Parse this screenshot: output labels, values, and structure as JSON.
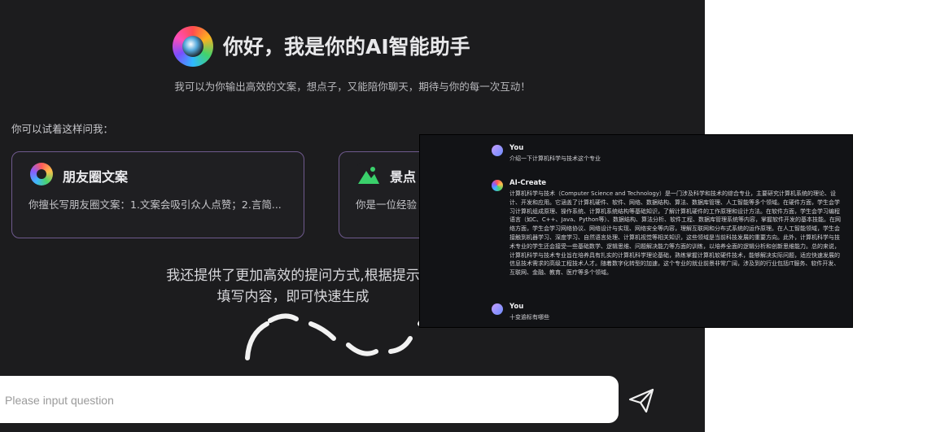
{
  "header": {
    "title": "你好，我是你的AI智能助手",
    "subtitle": "我可以为你输出高效的文案，想点子，又能陪你聊天，期待与你的每一次互动！"
  },
  "prompt_label": "你可以试着这样问我：",
  "cards": [
    {
      "icon": "color-wheel-icon",
      "title": "朋友圈文案",
      "desc": "你擅长写朋友圈文案：1.文案会吸引众人点赞；2.言简..."
    },
    {
      "icon": "landscape-icon",
      "title": "景点",
      "desc": "你是一位经验"
    }
  ],
  "tip": {
    "line1": "我还提供了更加高效的提问方式,根据提示",
    "line2": "填写内容，即可快速生成"
  },
  "input": {
    "placeholder": "Please input question"
  },
  "chat": {
    "messages": [
      {
        "sender": "You",
        "text": "介绍一下计算机科学与技术这个专业"
      },
      {
        "sender": "AI-Create",
        "text": "计算机科学与技术（Computer Science and Technology）是一门涉及科学和技术的综合专业，主要研究计算机系统的理论、设计、开发和应用。它涵盖了计算机硬件、软件、网络、数据结构、算法、数据库管理、人工智能等多个领域。在硬件方面，学生会学习计算机组成原理、操作系统、计算机系统结构等基础知识，了解计算机硬件的工作原理和设计方法。在软件方面，学生会学习编程语言（如C、C++、Java、Python等）、数据结构、算法分析、软件工程、数据库管理系统等内容，掌握软件开发的基本技能。在网络方面，学生会学习网络协议、网络设计与实现、网络安全等内容，理解互联网和分布式系统的运作原理。在人工智能领域，学生会接触到机器学习、深度学习、自然语言处理、计算机视觉等相关知识，这些领域是当前科技发展的重要方向。此外，计算机科学与技术专业的学生还会接受一些基础数学、逻辑思维、问题解决能力等方面的训练，以培养全面的逻辑分析和创新思维能力。总的来说，计算机科学与技术专业旨在培养具有扎实的计算机科学理论基础，熟练掌握计算机软硬件技术，能够解决实际问题，适应快速发展的信息技术需求的高级工程技术人才。随着数字化转型的加速，这个专业的就业前景非常广阔，涉及到的行业包括IT服务、软件开发、互联网、金融、教育、医疗等多个领域。"
      },
      {
        "sender": "You",
        "text": "十变逾标有哪些"
      }
    ]
  },
  "colors": {
    "app_bg": "#1c1c1e",
    "card_border": "#6f5a8e",
    "chat_bg": "#121316"
  }
}
